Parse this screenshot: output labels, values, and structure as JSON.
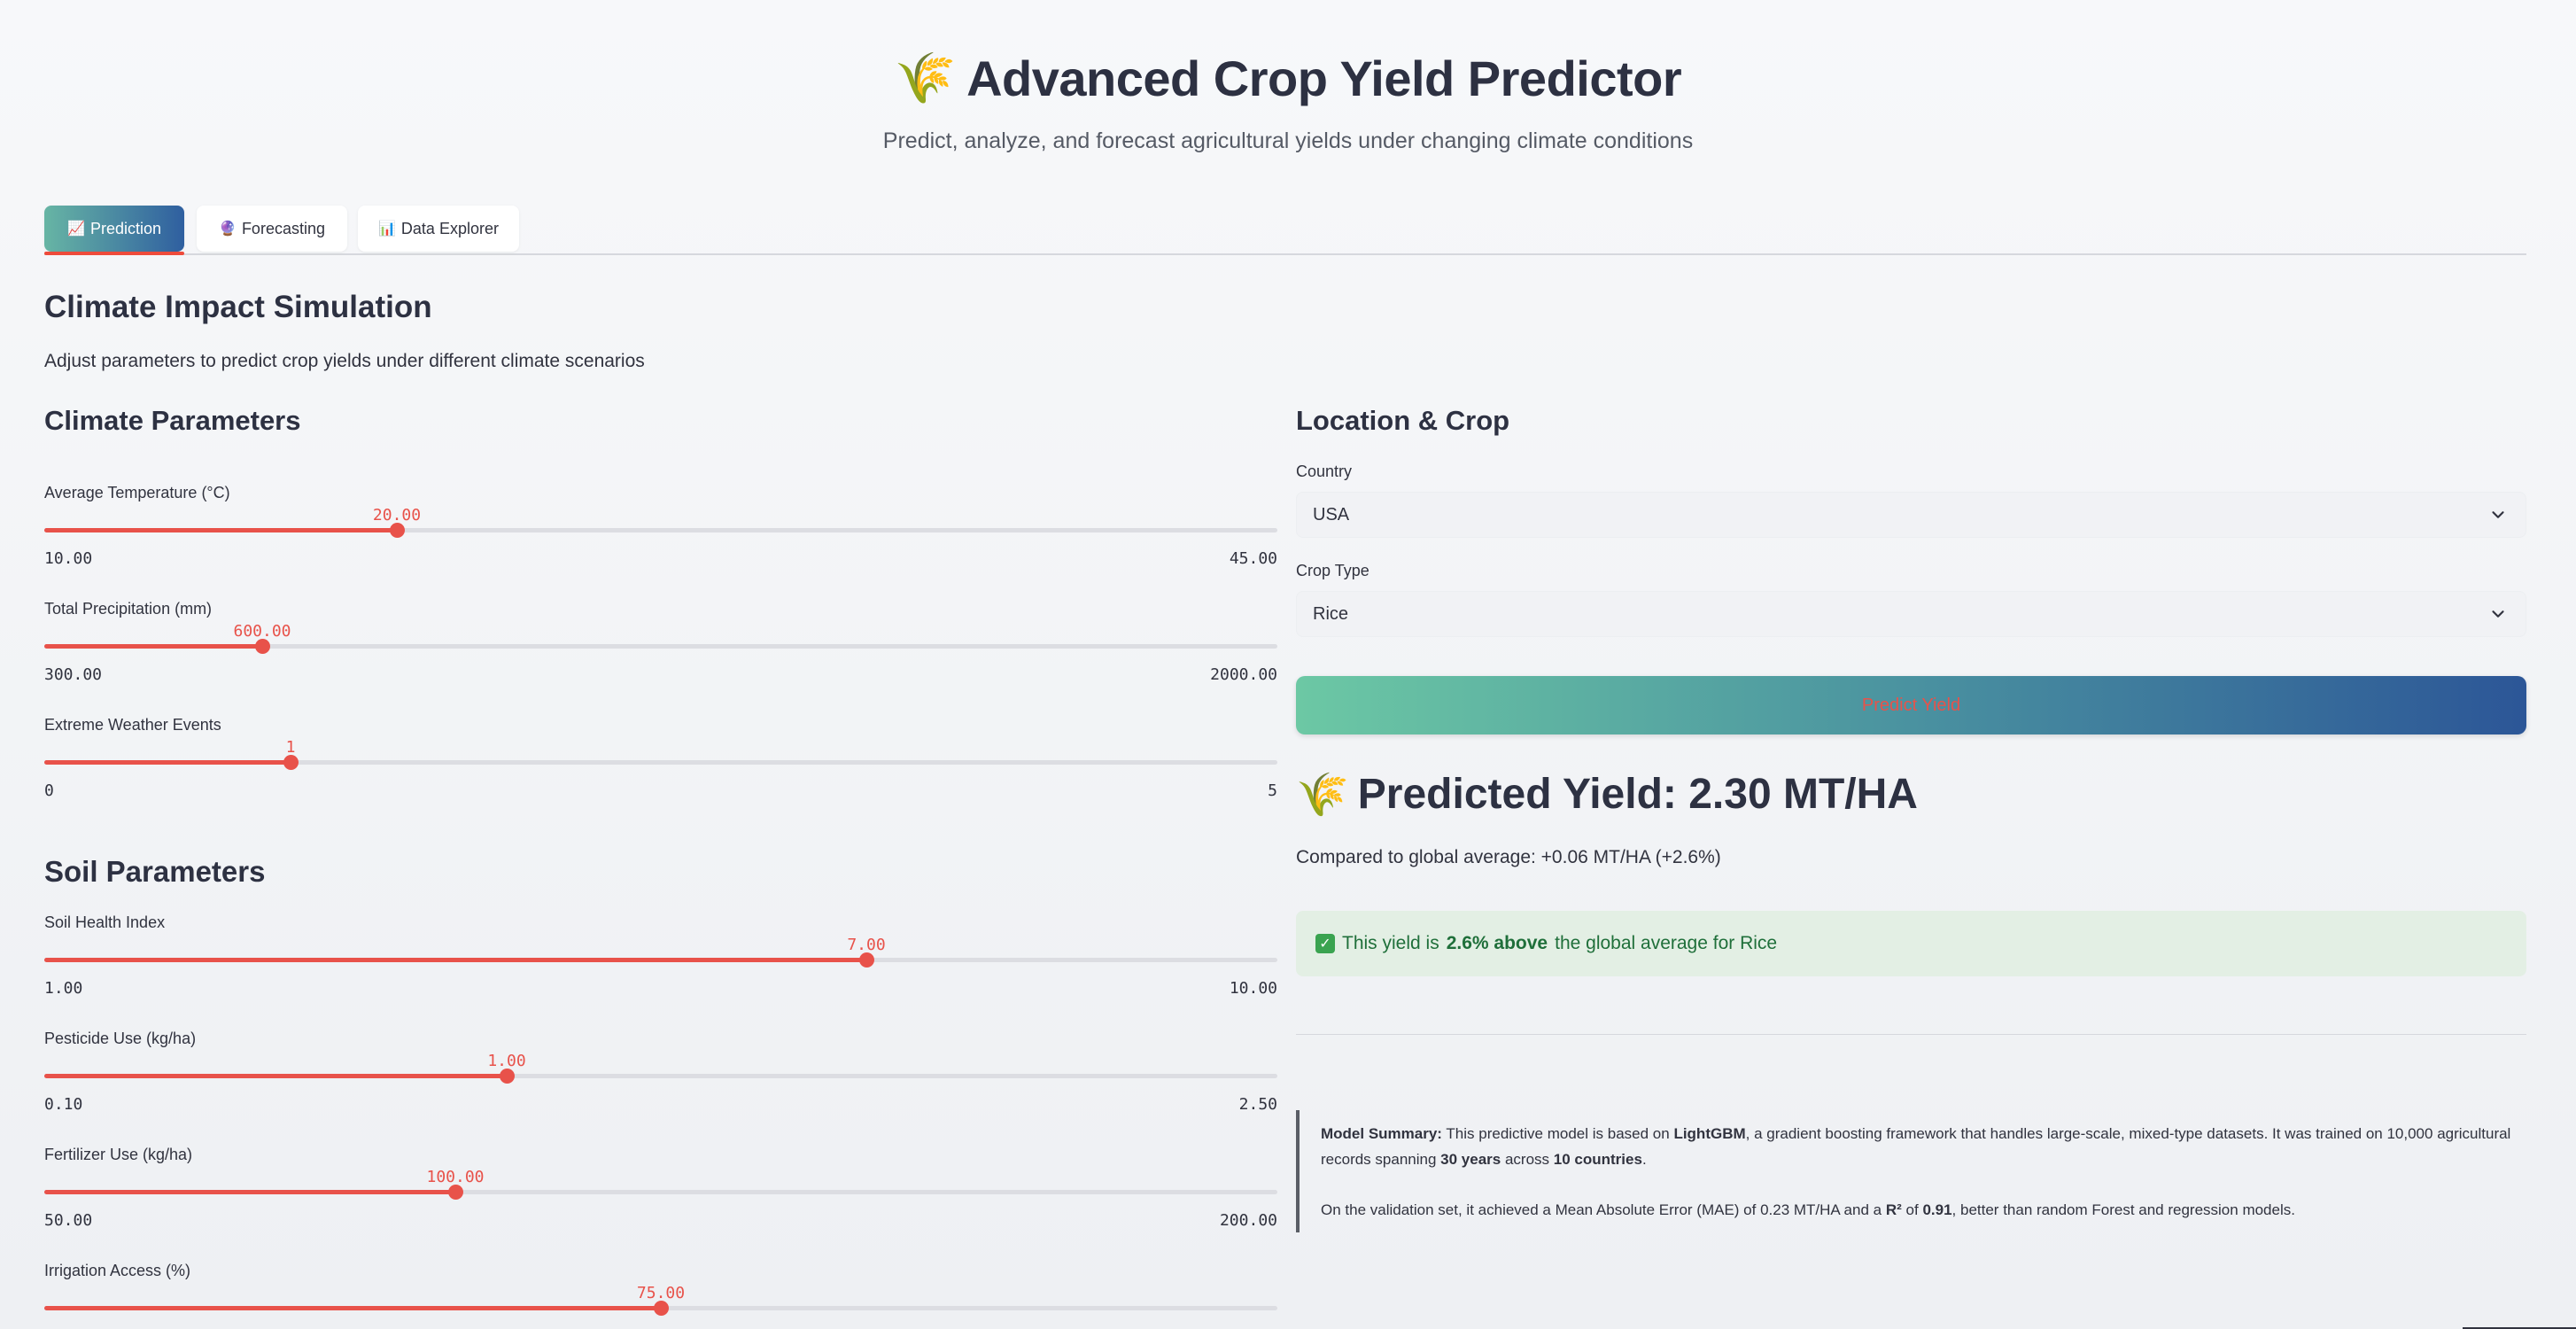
{
  "header": {
    "icon": "wheat-icon",
    "title": "Advanced Crop Yield Predictor",
    "subtitle": "Predict, analyze, and forecast agricultural yields under changing climate conditions"
  },
  "tabs": [
    {
      "label": "Prediction",
      "icon": "chart-up-icon",
      "active": true
    },
    {
      "label": "Forecasting",
      "icon": "crystal-ball-icon",
      "active": false
    },
    {
      "label": "Data Explorer",
      "icon": "bar-chart-icon",
      "active": false
    }
  ],
  "page": {
    "title": "Climate Impact Simulation",
    "description": "Adjust parameters to predict crop yields under different climate scenarios"
  },
  "climate": {
    "title": "Climate Parameters",
    "sliders": [
      {
        "label": "Average Temperature (°C)",
        "value": "20.00",
        "min": "10.00",
        "max": "45.00",
        "fraction": 0.2857
      },
      {
        "label": "Total Precipitation (mm)",
        "value": "600.00",
        "min": "300.00",
        "max": "2000.00",
        "fraction": 0.1765
      },
      {
        "label": "Extreme Weather Events",
        "value": "1",
        "min": "0",
        "max": "5",
        "fraction": 0.2
      }
    ]
  },
  "soil": {
    "title": "Soil Parameters",
    "sliders": [
      {
        "label": "Soil Health Index",
        "value": "7.00",
        "min": "1.00",
        "max": "10.00",
        "fraction": 0.6667
      },
      {
        "label": "Pesticide Use (kg/ha)",
        "value": "1.00",
        "min": "0.10",
        "max": "2.50",
        "fraction": 0.375
      },
      {
        "label": "Fertilizer Use (kg/ha)",
        "value": "100.00",
        "min": "50.00",
        "max": "200.00",
        "fraction": 0.3333
      },
      {
        "label": "Irrigation Access (%)",
        "value": "75.00",
        "min": "",
        "max": "",
        "fraction": 0.5
      }
    ]
  },
  "location": {
    "title": "Location & Crop",
    "country_label": "Country",
    "country_value": "USA",
    "crop_label": "Crop Type",
    "crop_value": "Rice"
  },
  "predict_button": "Predict Yield",
  "result": {
    "title": "Predicted Yield: 2.30 MT/HA",
    "comparison": "Compared to global average: +0.06 MT/HA (+2.6%)",
    "alert_prefix": "This yield is",
    "alert_bold": "2.6% above",
    "alert_suffix": "the global average for Rice"
  },
  "summary": {
    "p1_label": "Model Summary:",
    "p1_a": "This predictive model is based on",
    "p1_model": "LightGBM",
    "p1_b": ", a gradient boosting framework that handles large-scale, mixed-type datasets. It was trained on 10,000 agricultural records spanning",
    "p1_years": "30 years",
    "p1_c": "across",
    "p1_countries": "10 countries",
    "p1_d": ".",
    "p2_a": "On the validation set, it achieved a Mean Absolute Error (MAE) of 0.23 MT/HA and a",
    "p2_r2": "R²",
    "p2_b": "of",
    "p2_r2val": "0.91",
    "p2_c": ", better than random Forest and regression models."
  },
  "colors": {
    "accent": "#e8524a",
    "tab_gradient_start": "#67b5a4",
    "tab_gradient_end": "#2f5fa0",
    "success_bg": "#e3efe4",
    "success_text": "#1f6f3a"
  }
}
